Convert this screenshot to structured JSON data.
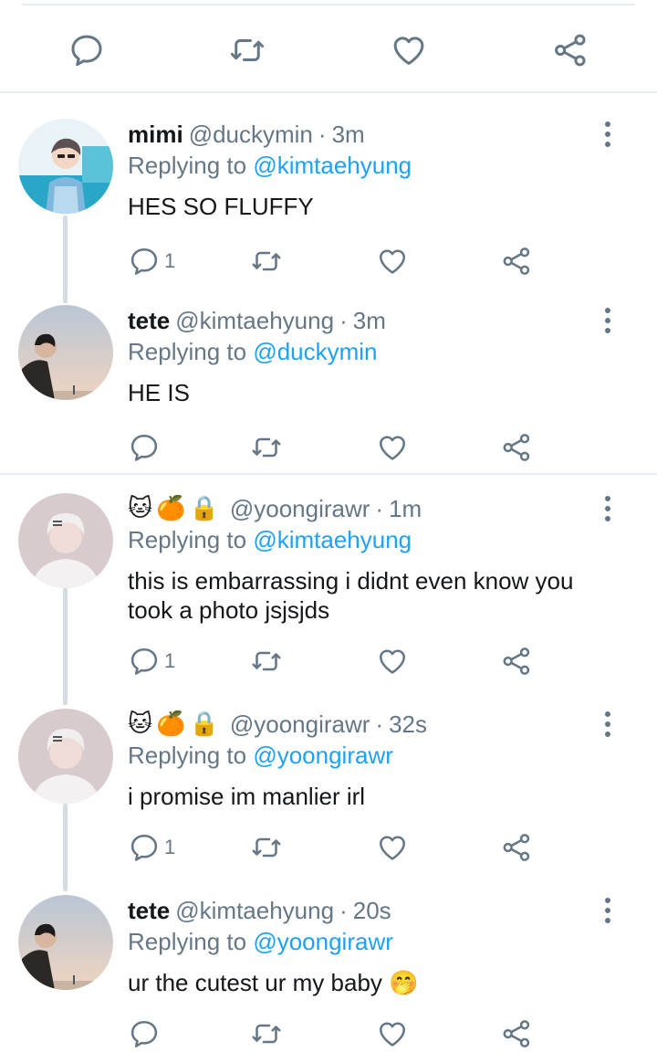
{
  "icons": {
    "reply": "reply-icon",
    "retweet": "retweet-icon",
    "like": "heart-icon",
    "share": "share-icon",
    "more": "more-vertical-icon"
  },
  "colors": {
    "text": "#14171a",
    "secondary": "#657786",
    "mention": "#1da1f2",
    "divider": "#e6ecf0",
    "thread_line": "#d5dbe0"
  },
  "tweets": [
    {
      "name": "mimi",
      "handle": "@duckymin",
      "sep": "·",
      "time": "3m",
      "reply_prefix": "Replying to ",
      "reply_to": "@kimtaehyung",
      "text": "HES SO FLUFFY",
      "reply_count": "1"
    },
    {
      "name": "tete",
      "handle": "@kimtaehyung",
      "sep": "·",
      "time": "3m",
      "reply_prefix": "Replying to ",
      "reply_to": "@duckymin",
      "text": "HE IS",
      "reply_count": ""
    },
    {
      "name_emojis": [
        "🐱",
        "🍊",
        "🔒"
      ],
      "handle": "@yoongirawr",
      "sep": "·",
      "time": "1m",
      "reply_prefix": "Replying to ",
      "reply_to": "@kimtaehyung",
      "text_line1": "this is embarrassing i didnt even know you",
      "text_line2": "took a photo jsjsjds",
      "reply_count": "1"
    },
    {
      "name_emojis": [
        "🐱",
        "🍊",
        "🔒"
      ],
      "handle": "@yoongirawr",
      "sep": "·",
      "time": "32s",
      "reply_prefix": "Replying to ",
      "reply_to": "@yoongirawr",
      "text": "i promise im manlier irl",
      "reply_count": "1"
    },
    {
      "name": "tete",
      "handle": "@kimtaehyung",
      "sep": "·",
      "time": "20s",
      "reply_prefix": "Replying to ",
      "reply_to": "@yoongirawr",
      "text": "ur the cutest ur my baby",
      "text_emoji": "🤭",
      "reply_count": ""
    }
  ]
}
